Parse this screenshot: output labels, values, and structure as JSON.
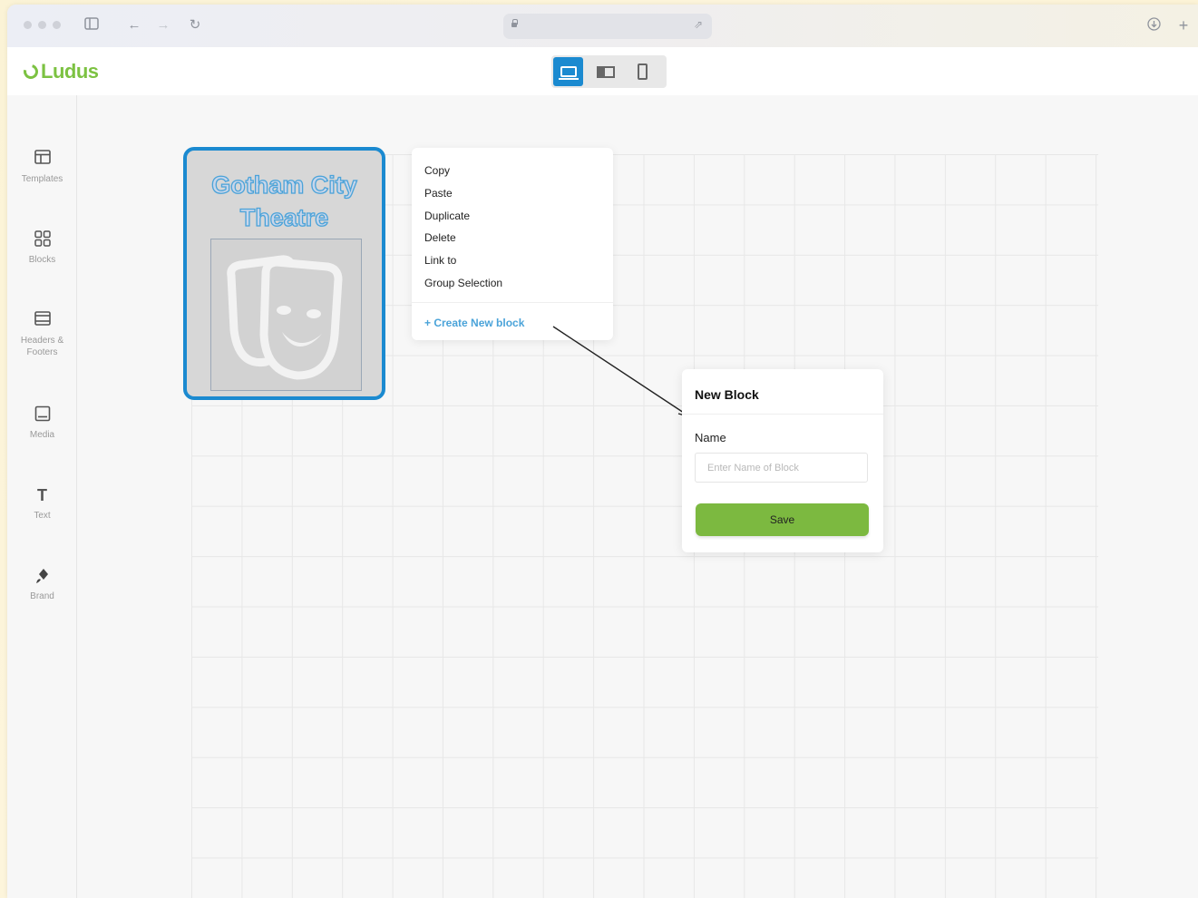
{
  "app": {
    "name": "Ludus",
    "brand_color": "#7cc242",
    "accent_color": "#1b8ad0"
  },
  "browser": {
    "icons": [
      "sidebar-icon",
      "back-icon",
      "forward-icon",
      "reload-icon",
      "lock-icon",
      "share-icon",
      "download-icon",
      "new-tab-icon"
    ]
  },
  "device_toggle": {
    "options": [
      {
        "icon": "laptop-icon",
        "active": true
      },
      {
        "icon": "split-view-icon",
        "active": false
      },
      {
        "icon": "phone-icon",
        "active": false
      }
    ]
  },
  "sidebar": {
    "items": [
      {
        "icon": "templates-icon",
        "label": "Templates"
      },
      {
        "icon": "blocks-icon",
        "label": "Blocks"
      },
      {
        "icon": "headers-footers-icon",
        "label": "Headers & Footers"
      },
      {
        "icon": "media-icon",
        "label": "Media"
      },
      {
        "icon": "text-icon",
        "label": "Text"
      },
      {
        "icon": "brand-icon",
        "label": "Brand"
      }
    ]
  },
  "poster": {
    "title": "Gotham City Theatre",
    "image_icon": "theatre-masks-icon"
  },
  "context_menu": {
    "items": [
      "Copy",
      "Paste",
      "Duplicate",
      "Delete",
      "Link to",
      "Group Selection"
    ],
    "create_label": "+ Create New block"
  },
  "new_block_dialog": {
    "title": "New Block",
    "name_label": "Name",
    "name_placeholder": "Enter Name of Block",
    "name_value": "",
    "save_label": "Save",
    "save_color": "#7cb940"
  }
}
